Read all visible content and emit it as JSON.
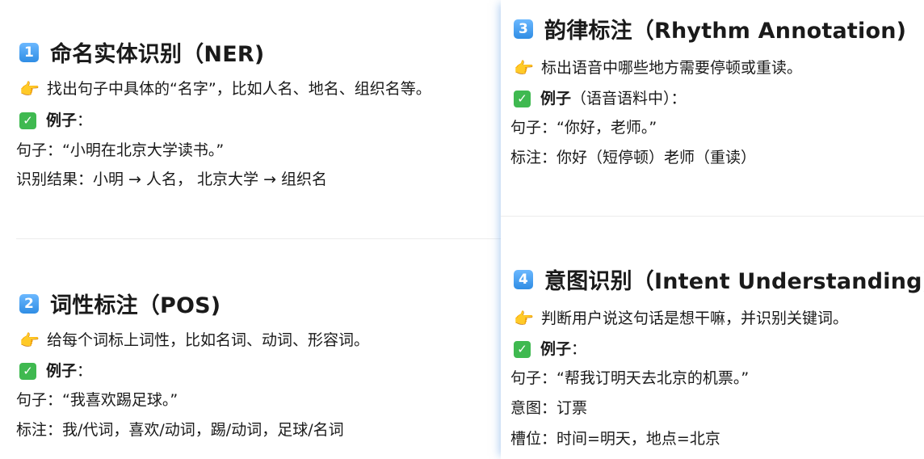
{
  "sections": [
    {
      "number": "1",
      "title": "命名实体识别（NER)",
      "point_emoji": "👉",
      "desc": "找出句子中具体的“名字”，比如人名、地名、组织名等。",
      "example_label": "例子",
      "example_suffix": "：",
      "lines": [
        "句子：“小明在北京大学读书。”",
        "识别结果：小明 → 人名， 北京大学 → 组织名"
      ]
    },
    {
      "number": "2",
      "title": "词性标注（POS)",
      "point_emoji": "👉",
      "desc": "给每个词标上词性，比如名词、动词、形容词。",
      "example_label": "例子",
      "example_suffix": "：",
      "lines": [
        "句子：“我喜欢踢足球。”",
        "标注：我/代词，喜欢/动词，踢/动词，足球/名词"
      ]
    },
    {
      "number": "3",
      "title": "韵律标注（Rhythm Annotation)",
      "point_emoji": "👉",
      "desc": "标出语音中哪些地方需要停顿或重读。",
      "example_label": "例子",
      "example_suffix": "（语音语料中）：",
      "lines": [
        "句子：“你好，老师。”",
        "标注：你好（短停顿）老师（重读）"
      ]
    },
    {
      "number": "4",
      "title": "意图识别（Intent Understanding)",
      "point_emoji": "👉",
      "desc": "判断用户说这句话是想干嘛，并识别关键词。",
      "example_label": "例子",
      "example_suffix": "：",
      "lines": [
        "句子：“帮我订明天去北京的机票。”",
        "意图：订票",
        "槽位：时间=明天，地点=北京"
      ]
    }
  ],
  "colors": {
    "badge": "#2f8de4",
    "check": "#3fb950"
  },
  "icons": {
    "point": "pointing-hand-icon",
    "check": "check-mark-icon"
  }
}
